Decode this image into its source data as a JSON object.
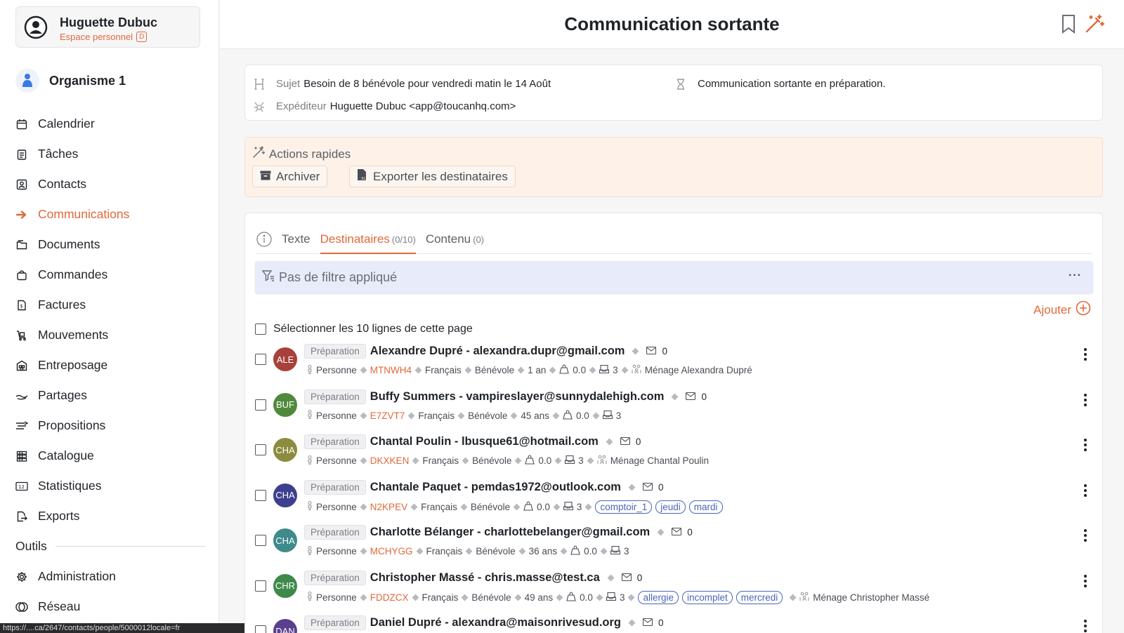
{
  "user": {
    "name": "Huguette Dubuc",
    "space_label": "Espace personnel",
    "space_badge": "D"
  },
  "org": {
    "name": "Organisme 1"
  },
  "nav": [
    {
      "label": "Calendrier",
      "icon": "calendar-icon"
    },
    {
      "label": "Tâches",
      "icon": "tasks-icon"
    },
    {
      "label": "Contacts",
      "icon": "contacts-icon"
    },
    {
      "label": "Communications",
      "icon": "arrow-right-icon",
      "active": true
    },
    {
      "label": "Documents",
      "icon": "documents-icon"
    },
    {
      "label": "Commandes",
      "icon": "shopping-bag-icon"
    },
    {
      "label": "Factures",
      "icon": "invoice-icon"
    },
    {
      "label": "Mouvements",
      "icon": "cart-icon"
    },
    {
      "label": "Entreposage",
      "icon": "warehouse-icon"
    },
    {
      "label": "Partages",
      "icon": "handshake-icon"
    },
    {
      "label": "Propositions",
      "icon": "propositions-icon"
    },
    {
      "label": "Catalogue",
      "icon": "catalogue-icon"
    },
    {
      "label": "Statistiques",
      "icon": "stats-icon"
    },
    {
      "label": "Exports",
      "icon": "export-icon"
    }
  ],
  "nav_section": {
    "label": "Outils"
  },
  "nav_tools": [
    {
      "label": "Administration",
      "icon": "gear-icon"
    },
    {
      "label": "Réseau",
      "icon": "network-icon"
    }
  ],
  "status_url": "https://....ca/2647/contacts/people/5000012locale=fr",
  "header": {
    "title": "Communication sortante"
  },
  "info": {
    "subject_label": "Sujet",
    "subject_value": "Besoin de 8 bénévole pour vendredi matin le 14 Août",
    "sender_label": "Expéditeur",
    "sender_value": "Huguette Dubuc <app@toucanhq.com>",
    "status_text": "Communication sortante en préparation."
  },
  "quick_actions": {
    "title": "Actions rapides",
    "archive_label": "Archiver",
    "export_label": "Exporter les destinataires"
  },
  "tabs": [
    {
      "label": "Texte",
      "count": ""
    },
    {
      "label": "Destinataires",
      "count": "(0/10)",
      "active": true
    },
    {
      "label": "Contenu",
      "count": "(0)"
    }
  ],
  "filter": {
    "label": "Pas de filtre appliqué",
    "more": "···"
  },
  "add_label": "Ajouter",
  "select_all_label": "Sélectionner les 10 lignes de cette page",
  "rows": [
    {
      "initials": "ALE",
      "color": "#a8413b",
      "status": "Préparation",
      "name": "Alexandre Dupré - alexandra.dupr@gmail.com",
      "mail": "0",
      "type": "Personne",
      "code": "MTNWH4",
      "lang": "Français",
      "role": "Bénévole",
      "age": "1 an",
      "score": "0.0",
      "count": "3",
      "tags": [],
      "household": "Ménage Alexandra Dupré"
    },
    {
      "initials": "BUF",
      "color": "#4f8a3c",
      "status": "Préparation",
      "name": "Buffy Summers - vampireslayer@sunnydalehigh.com",
      "mail": "0",
      "type": "Personne",
      "code": "E7ZVT7",
      "lang": "Français",
      "role": "Bénévole",
      "age": "45 ans",
      "score": "0.0",
      "count": "3",
      "tags": [],
      "household": ""
    },
    {
      "initials": "CHA",
      "color": "#8c8b3f",
      "status": "Préparation",
      "name": "Chantal Poulin - lbusque61@hotmail.com",
      "mail": "0",
      "type": "Personne",
      "code": "DKXKEN",
      "lang": "Français",
      "role": "Bénévole",
      "age": "",
      "score": "0.0",
      "count": "3",
      "tags": [],
      "household": "Ménage Chantal Poulin"
    },
    {
      "initials": "CHA",
      "color": "#3d3f8e",
      "status": "Préparation",
      "name": "Chantale Paquet - pemdas1972@outlook.com",
      "mail": "0",
      "type": "Personne",
      "code": "N2KPEV",
      "lang": "Français",
      "role": "Bénévole",
      "age": "",
      "score": "0.0",
      "count": "3",
      "tags": [
        "comptoir_1",
        "jeudi",
        "mardi"
      ],
      "household": ""
    },
    {
      "initials": "CHA",
      "color": "#3f8a8a",
      "status": "Préparation",
      "name": "Charlotte Bélanger - charlottebelanger@gmail.com",
      "mail": "0",
      "type": "Personne",
      "code": "MCHYGG",
      "lang": "Français",
      "role": "Bénévole",
      "age": "36 ans",
      "score": "0.0",
      "count": "3",
      "tags": [],
      "household": ""
    },
    {
      "initials": "CHR",
      "color": "#3f8a4a",
      "status": "Préparation",
      "name": "Christopher Massé - chris.masse@test.ca",
      "mail": "0",
      "type": "Personne",
      "code": "FDDZCX",
      "lang": "Français",
      "role": "Bénévole",
      "age": "49 ans",
      "score": "0.0",
      "count": "3",
      "tags": [
        "allergie",
        "incomplet",
        "mercredi"
      ],
      "household": "Ménage Christopher Massé"
    },
    {
      "initials": "DAN",
      "color": "#5a3f8e",
      "status": "Préparation",
      "name": "Daniel Dupré - alexandra@maisonrivesud.org",
      "mail": "0",
      "type": "",
      "code": "",
      "lang": "",
      "role": "",
      "age": "",
      "score": "",
      "count": "",
      "tags": [],
      "household": ""
    }
  ],
  "colors": {
    "accent": "#e0693a",
    "tag": "#4a66b8",
    "filter_bg": "#e8ebf9",
    "quick_bg": "#fdf1e8"
  }
}
